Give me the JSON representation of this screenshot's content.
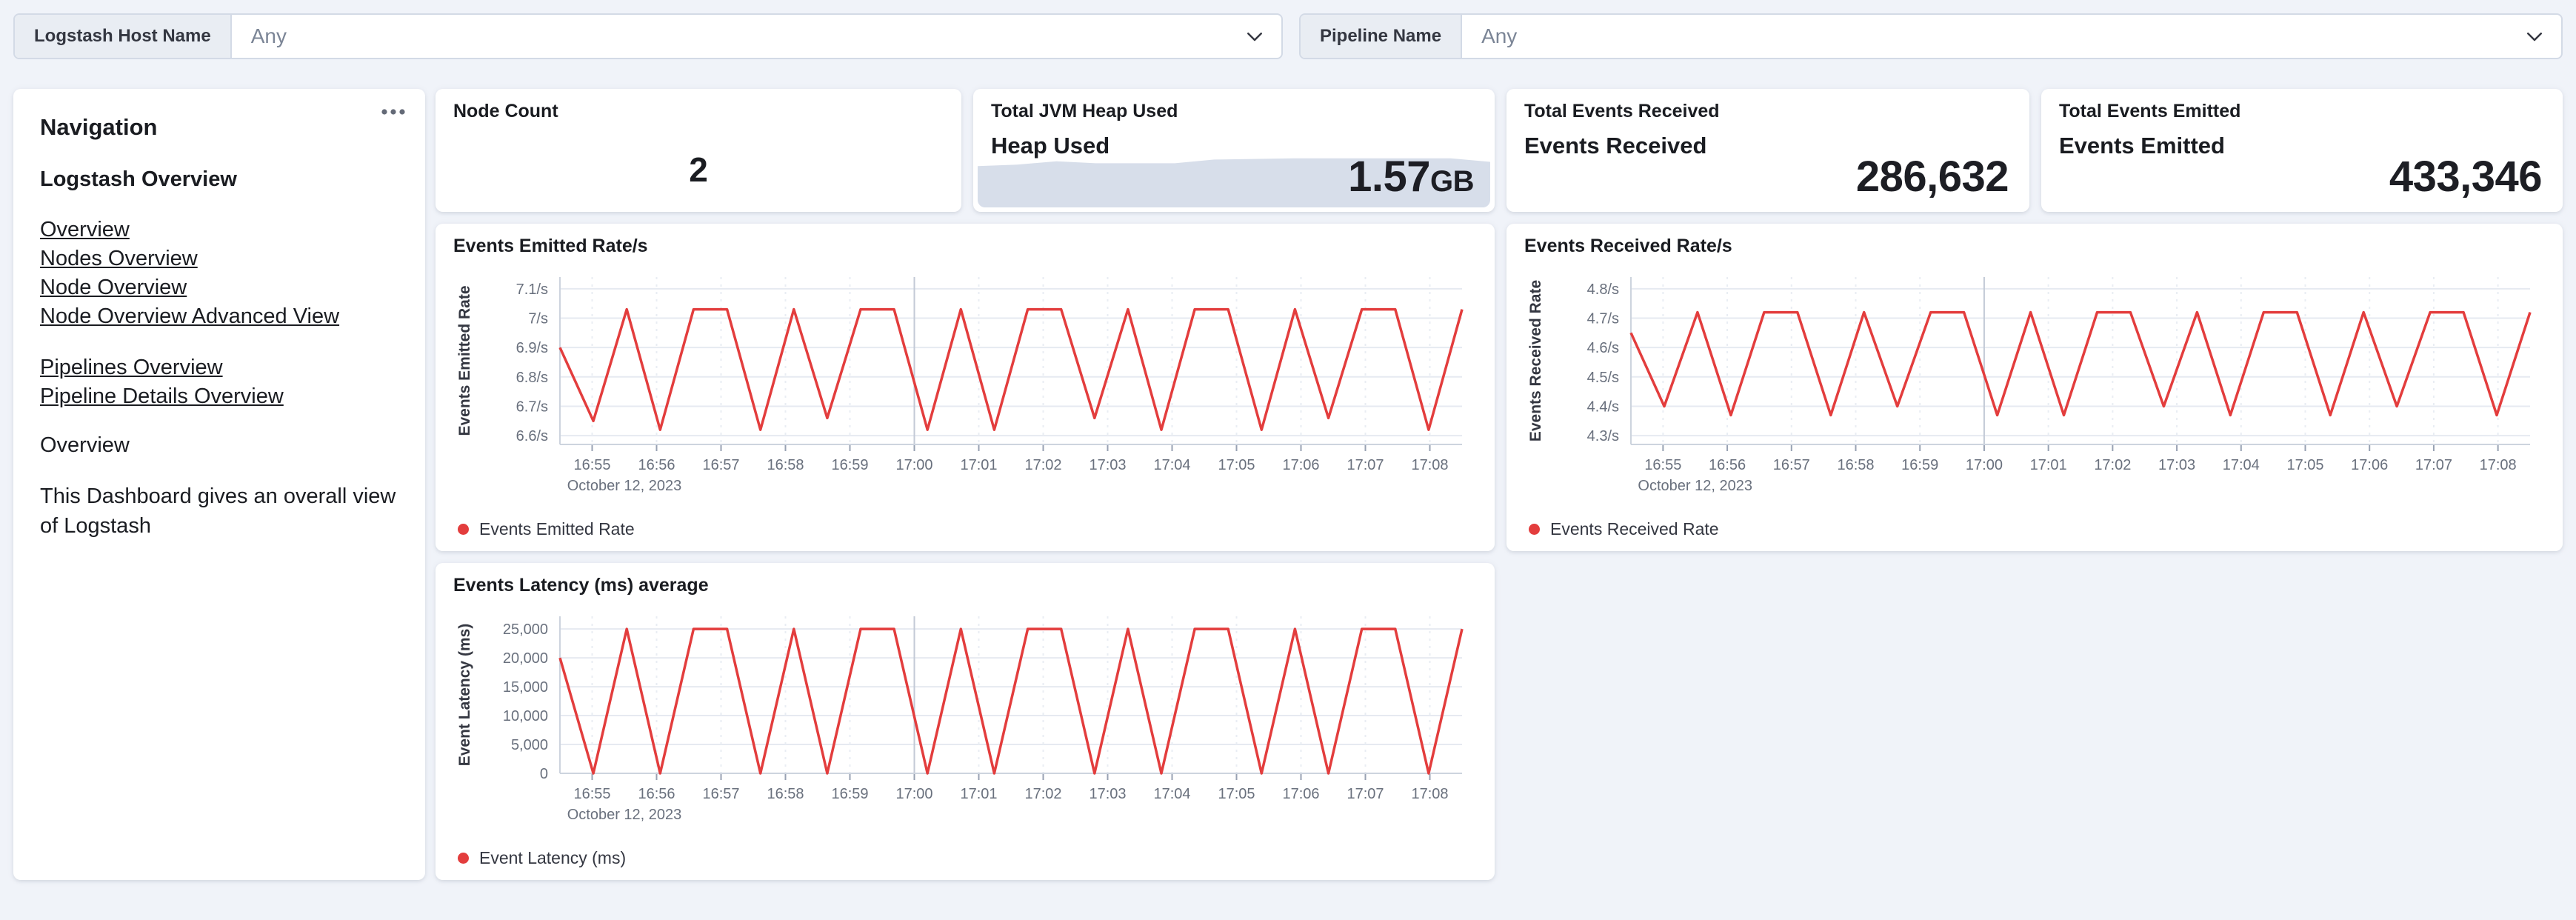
{
  "filters": {
    "host": {
      "label": "Logstash Host Name",
      "value": "Any"
    },
    "pipeline": {
      "label": "Pipeline Name",
      "value": "Any"
    }
  },
  "navigation": {
    "title": "Navigation",
    "section_title": "Logstash Overview",
    "links_group1": [
      "Overview",
      "Nodes Overview",
      "Node Overview",
      "Node Overview Advanced View"
    ],
    "links_group2": [
      "Pipelines Overview",
      "Pipeline Details Overview"
    ],
    "subheading": "Overview",
    "description": "This Dashboard gives an overall view of Logstash"
  },
  "metrics": {
    "node_count": {
      "panel_title": "Node Count",
      "value": "2"
    },
    "jvm_heap": {
      "panel_title": "Total JVM Heap Used",
      "label": "Heap Used",
      "value": "1.57",
      "unit": "GB"
    },
    "events_received": {
      "panel_title": "Total Events Received",
      "label": "Events Received",
      "value": "286,632"
    },
    "events_emitted": {
      "panel_title": "Total Events Emitted",
      "label": "Events Emitted",
      "value": "433,346"
    }
  },
  "chart_data": [
    {
      "id": "events_emitted_rate",
      "type": "line",
      "title": "Events Emitted Rate/s",
      "ylabel": "Events Emitted Rate",
      "legend": "Events Emitted Rate",
      "legend_position": "bottom-left",
      "color": "#e33d3d",
      "grid": true,
      "ylim": [
        6.57,
        7.14
      ],
      "y_tick_values": [
        6.6,
        6.7,
        6.8,
        6.9,
        7.0,
        7.1
      ],
      "y_tick_labels": [
        "6.6/s",
        "6.7/s",
        "6.8/s",
        "6.9/s",
        "7/s",
        "7.1/s"
      ],
      "x_labels": [
        "16:55",
        "16:56",
        "16:57",
        "16:58",
        "16:59",
        "17:00",
        "17:01",
        "17:02",
        "17:03",
        "17:04",
        "17:05",
        "17:06",
        "17:07",
        "17:08"
      ],
      "x_sublabel": "October 12, 2023",
      "highlight_x": "17:00",
      "values": [
        6.9,
        6.65,
        7.03,
        6.62,
        7.03,
        7.03,
        6.62,
        7.03,
        6.66,
        7.03,
        7.03,
        6.62,
        7.03,
        6.62,
        7.03,
        7.03,
        6.66,
        7.03,
        6.62,
        7.03,
        7.03,
        6.62,
        7.03,
        6.66,
        7.03,
        7.03,
        6.62,
        7.03
      ]
    },
    {
      "id": "events_received_rate",
      "type": "line",
      "title": "Events Received Rate/s",
      "ylabel": "Events Received Rate",
      "legend": "Events Received Rate",
      "legend_position": "bottom-left",
      "color": "#e33d3d",
      "grid": true,
      "ylim": [
        4.27,
        4.84
      ],
      "y_tick_values": [
        4.3,
        4.4,
        4.5,
        4.6,
        4.7,
        4.8
      ],
      "y_tick_labels": [
        "4.3/s",
        "4.4/s",
        "4.5/s",
        "4.6/s",
        "4.7/s",
        "4.8/s"
      ],
      "x_labels": [
        "16:55",
        "16:56",
        "16:57",
        "16:58",
        "16:59",
        "17:00",
        "17:01",
        "17:02",
        "17:03",
        "17:04",
        "17:05",
        "17:06",
        "17:07",
        "17:08"
      ],
      "x_sublabel": "October 12, 2023",
      "highlight_x": "17:00",
      "values": [
        4.65,
        4.4,
        4.72,
        4.37,
        4.72,
        4.72,
        4.37,
        4.72,
        4.4,
        4.72,
        4.72,
        4.37,
        4.72,
        4.37,
        4.72,
        4.72,
        4.4,
        4.72,
        4.37,
        4.72,
        4.72,
        4.37,
        4.72,
        4.4,
        4.72,
        4.72,
        4.37,
        4.72
      ]
    },
    {
      "id": "events_latency",
      "type": "line",
      "title": "Events Latency (ms) average",
      "ylabel": "Event Latency (ms)",
      "legend": "Event Latency (ms)",
      "legend_position": "bottom-left",
      "color": "#e33d3d",
      "grid": true,
      "ylim": [
        0,
        27200
      ],
      "y_tick_values": [
        0,
        5000,
        10000,
        15000,
        20000,
        25000
      ],
      "y_tick_labels": [
        "0",
        "5,000",
        "10,000",
        "15,000",
        "20,000",
        "25,000"
      ],
      "x_labels": [
        "16:55",
        "16:56",
        "16:57",
        "16:58",
        "16:59",
        "17:00",
        "17:01",
        "17:02",
        "17:03",
        "17:04",
        "17:05",
        "17:06",
        "17:07",
        "17:08"
      ],
      "x_sublabel": "October 12, 2023",
      "highlight_x": "17:00",
      "values": [
        20000,
        0,
        25000,
        0,
        25000,
        25000,
        0,
        25000,
        0,
        25000,
        25000,
        0,
        25000,
        0,
        25000,
        25000,
        0,
        25000,
        0,
        25000,
        25000,
        0,
        25000,
        0,
        25000,
        25000,
        0,
        25000
      ]
    },
    {
      "id": "heap_used_spark",
      "type": "area",
      "title": "Heap Used",
      "color": "#d7deea",
      "ylim": [
        0,
        2.6
      ],
      "values": [
        1.45,
        1.5,
        1.62,
        1.55,
        1.55,
        1.55,
        1.68,
        1.7,
        1.72,
        1.72,
        1.72,
        1.72,
        1.72,
        1.6
      ]
    }
  ]
}
